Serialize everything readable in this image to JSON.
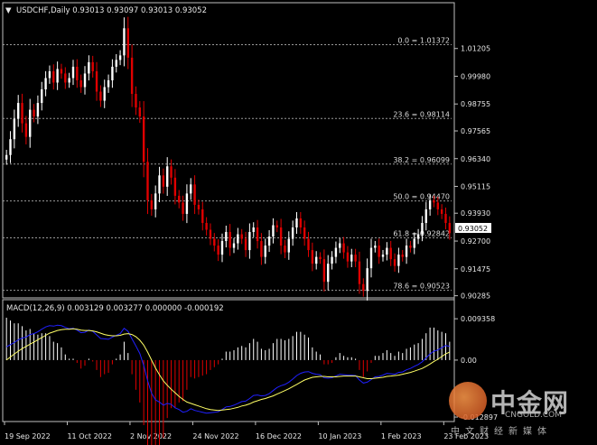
{
  "header": {
    "arrow": "▼",
    "text": "USDCHF,Daily  0.93013 0.93097 0.93013 0.93052"
  },
  "current_price": "0.93052",
  "macd_header": "MACD(12,26,9) 0.003129 0.003277 0.000000 -0.000192",
  "colors": {
    "background": "#000000",
    "bull_candle": "#ffffff",
    "bear_candle": "#e00000",
    "fib_line": "#9a9a9a",
    "histogram_pos": "#ffffff",
    "histogram_neg": "#e00000",
    "macd_line": "#2020ff",
    "signal_line": "#ffff66"
  },
  "watermark": {
    "title": "中金网",
    "url": "CNGOLD.COM",
    "slogan": "中文财经新媒体"
  },
  "chart_data": [
    {
      "type": "candlestick",
      "symbol": "USDCHF",
      "timeframe": "Daily",
      "ylim": [
        0.9027,
        1.0255
      ],
      "y_ticks": [
        "1.01205",
        "0.99980",
        "0.98755",
        "0.97565",
        "0.96340",
        "0.95115",
        "0.93930",
        "0.92700",
        "0.91475",
        "0.90285"
      ],
      "y_tick_values": [
        1.01205,
        0.9998,
        0.98755,
        0.97565,
        0.9634,
        0.95115,
        0.9393,
        0.927,
        0.91475,
        0.90285
      ],
      "x_ticks": [
        "19 Sep 2022",
        "11 Oct 2022",
        "2 Nov 2022",
        "24 Nov 2022",
        "16 Dec 2022",
        "10 Jan 2023",
        "1 Feb 2023",
        "23 Feb 2023"
      ],
      "x_tick_index": [
        0,
        16,
        32,
        48,
        64,
        80,
        96,
        112
      ],
      "fibonacci": [
        {
          "label": "0.0 = 1.01372",
          "value": 1.01372
        },
        {
          "label": "23.6 = 0.98114",
          "value": 0.98114
        },
        {
          "label": "38.2 = 0.96099",
          "value": 0.96099
        },
        {
          "label": "50.0 = 0.94470",
          "value": 0.9447
        },
        {
          "label": "61.8 = 0.92842",
          "value": 0.92842
        },
        {
          "label": "78.6 = 0.90523",
          "value": 0.90523
        }
      ],
      "last_price": 0.93052,
      "close": [
        0.965,
        0.972,
        0.981,
        0.988,
        0.979,
        0.973,
        0.985,
        0.982,
        0.988,
        0.994,
        0.999,
        1.002,
        0.997,
        1.003,
        1.001,
        0.997,
        0.999,
        1.004,
        0.998,
        0.995,
        1.001,
        1.006,
        1.002,
        0.993,
        0.989,
        0.995,
        0.998,
        1.004,
        1.007,
        1.009,
        1.021,
        1.008,
        0.992,
        0.986,
        0.982,
        0.962,
        0.945,
        0.941,
        0.948,
        0.956,
        0.951,
        0.96,
        0.955,
        0.947,
        0.944,
        0.939,
        0.948,
        0.952,
        0.943,
        0.941,
        0.935,
        0.932,
        0.928,
        0.925,
        0.921,
        0.927,
        0.931,
        0.924,
        0.926,
        0.93,
        0.928,
        0.923,
        0.931,
        0.933,
        0.927,
        0.92,
        0.925,
        0.929,
        0.934,
        0.933,
        0.925,
        0.922,
        0.928,
        0.933,
        0.937,
        0.933,
        0.928,
        0.923,
        0.917,
        0.92,
        0.919,
        0.909,
        0.917,
        0.92,
        0.924,
        0.926,
        0.922,
        0.918,
        0.921,
        0.918,
        0.908,
        0.905,
        0.915,
        0.924,
        0.925,
        0.92,
        0.921,
        0.924,
        0.919,
        0.916,
        0.921,
        0.92,
        0.925,
        0.924,
        0.928,
        0.93,
        0.935,
        0.941,
        0.945,
        0.944,
        0.941,
        0.939,
        0.935,
        0.9305
      ]
    },
    {
      "type": "macd",
      "params": "12,26,9",
      "ylim": [
        -0.0135,
        0.01
      ],
      "y_ticks": [
        "0.009358",
        "0.00",
        "-0.012897"
      ],
      "y_tick_values": [
        0.009358,
        0.0,
        -0.012897
      ],
      "macd": [
        0.003,
        0.0035,
        0.004,
        0.0046,
        0.005,
        0.0052,
        0.0058,
        0.006,
        0.0064,
        0.007,
        0.0075,
        0.0078,
        0.0077,
        0.0079,
        0.0078,
        0.0074,
        0.0071,
        0.0072,
        0.0068,
        0.0062,
        0.0063,
        0.0068,
        0.0065,
        0.0057,
        0.0049,
        0.0048,
        0.0047,
        0.0052,
        0.0056,
        0.006,
        0.0072,
        0.0065,
        0.0048,
        0.0032,
        0.0015,
        -0.0012,
        -0.0047,
        -0.0075,
        -0.009,
        -0.0095,
        -0.0102,
        -0.0098,
        -0.01,
        -0.0108,
        -0.0112,
        -0.0118,
        -0.0116,
        -0.011,
        -0.0114,
        -0.0116,
        -0.0118,
        -0.012,
        -0.0119,
        -0.0118,
        -0.0117,
        -0.0112,
        -0.0106,
        -0.0105,
        -0.0102,
        -0.0098,
        -0.0094,
        -0.0093,
        -0.0087,
        -0.008,
        -0.0079,
        -0.0081,
        -0.008,
        -0.0076,
        -0.0069,
        -0.0062,
        -0.0058,
        -0.0055,
        -0.005,
        -0.0043,
        -0.0035,
        -0.003,
        -0.0027,
        -0.0026,
        -0.003,
        -0.0032,
        -0.0033,
        -0.004,
        -0.0041,
        -0.004,
        -0.0036,
        -0.0032,
        -0.0033,
        -0.0034,
        -0.0034,
        -0.0035,
        -0.0045,
        -0.0052,
        -0.005,
        -0.0044,
        -0.0038,
        -0.0037,
        -0.0034,
        -0.003,
        -0.0031,
        -0.0032,
        -0.0028,
        -0.0027,
        -0.0022,
        -0.0019,
        -0.0014,
        -0.001,
        -0.0004,
        0.0005,
        0.0014,
        0.002,
        0.0023,
        0.0028,
        0.0033,
        0.0031
      ],
      "signal": [
        0.0,
        0.0007,
        0.0014,
        0.002,
        0.0026,
        0.0031,
        0.0036,
        0.0041,
        0.0046,
        0.0051,
        0.0056,
        0.0061,
        0.0064,
        0.0067,
        0.0069,
        0.007,
        0.007,
        0.0071,
        0.007,
        0.0068,
        0.0067,
        0.0067,
        0.0066,
        0.0064,
        0.0061,
        0.0058,
        0.0056,
        0.0055,
        0.0055,
        0.0056,
        0.0059,
        0.006,
        0.0058,
        0.0053,
        0.0045,
        0.0034,
        0.0018,
        0.0,
        -0.0018,
        -0.0033,
        -0.0047,
        -0.0057,
        -0.0066,
        -0.0074,
        -0.0082,
        -0.0089,
        -0.0095,
        -0.0098,
        -0.0101,
        -0.0104,
        -0.0107,
        -0.011,
        -0.0112,
        -0.0113,
        -0.0114,
        -0.0113,
        -0.0112,
        -0.0111,
        -0.0109,
        -0.0107,
        -0.0104,
        -0.0102,
        -0.0099,
        -0.0095,
        -0.0092,
        -0.0089,
        -0.0087,
        -0.0084,
        -0.0081,
        -0.0077,
        -0.0073,
        -0.0069,
        -0.0065,
        -0.006,
        -0.0055,
        -0.005,
        -0.0045,
        -0.0042,
        -0.0039,
        -0.0038,
        -0.0037,
        -0.0037,
        -0.0038,
        -0.0038,
        -0.0038,
        -0.0037,
        -0.0036,
        -0.0036,
        -0.0036,
        -0.0036,
        -0.0038,
        -0.004,
        -0.0042,
        -0.0042,
        -0.0041,
        -0.004,
        -0.0039,
        -0.0037,
        -0.0036,
        -0.0035,
        -0.0034,
        -0.0032,
        -0.003,
        -0.0028,
        -0.0025,
        -0.0022,
        -0.0019,
        -0.0014,
        -0.0009,
        -0.0003,
        0.0002,
        0.0008,
        0.0014,
        0.0018
      ]
    }
  ]
}
